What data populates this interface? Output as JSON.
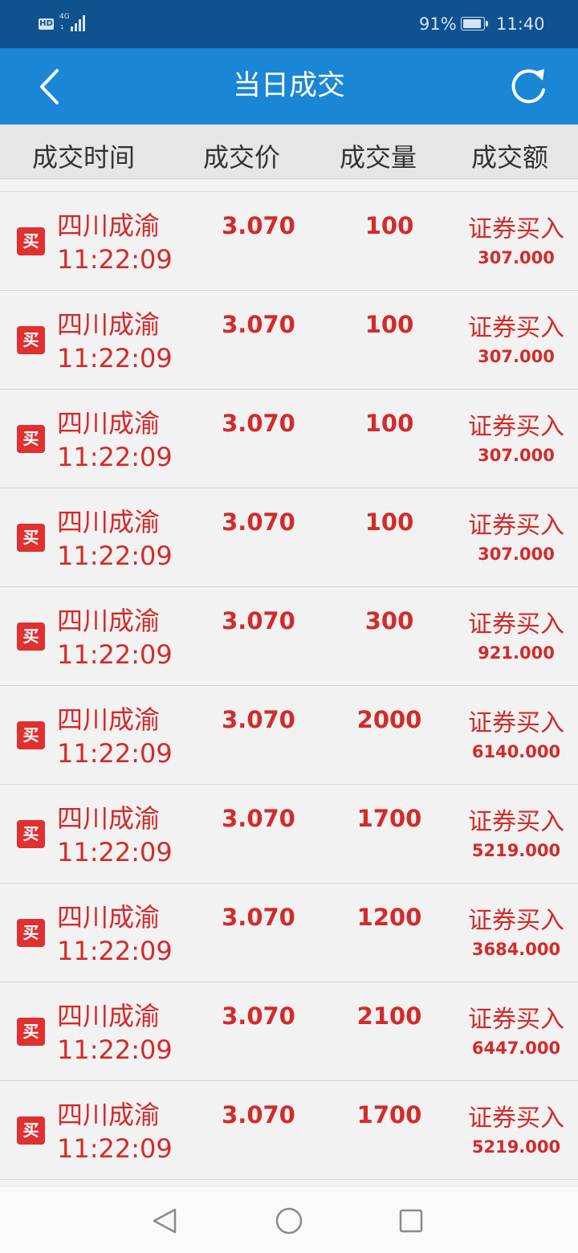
{
  "status_bar": {
    "hd_label": "HD",
    "network_label": "4G",
    "network_sub": "1",
    "battery_percent": "91%",
    "battery_level": 0.91,
    "time": "11:40"
  },
  "app_bar": {
    "title": "当日成交",
    "back_icon": "chevron-left-icon",
    "refresh_icon": "refresh-icon"
  },
  "table": {
    "columns": [
      "成交时间",
      "成交价",
      "成交量",
      "成交额"
    ],
    "rows": [
      {
        "badge": "买",
        "name": "四川成渝",
        "time": "11:22:09",
        "price": "3.070",
        "qty": "100",
        "type": "证券买入",
        "amount": "307.000"
      },
      {
        "badge": "买",
        "name": "四川成渝",
        "time": "11:22:09",
        "price": "3.070",
        "qty": "100",
        "type": "证券买入",
        "amount": "307.000"
      },
      {
        "badge": "买",
        "name": "四川成渝",
        "time": "11:22:09",
        "price": "3.070",
        "qty": "100",
        "type": "证券买入",
        "amount": "307.000"
      },
      {
        "badge": "买",
        "name": "四川成渝",
        "time": "11:22:09",
        "price": "3.070",
        "qty": "100",
        "type": "证券买入",
        "amount": "307.000"
      },
      {
        "badge": "买",
        "name": "四川成渝",
        "time": "11:22:09",
        "price": "3.070",
        "qty": "300",
        "type": "证券买入",
        "amount": "921.000"
      },
      {
        "badge": "买",
        "name": "四川成渝",
        "time": "11:22:09",
        "price": "3.070",
        "qty": "2000",
        "type": "证券买入",
        "amount": "6140.000"
      },
      {
        "badge": "买",
        "name": "四川成渝",
        "time": "11:22:09",
        "price": "3.070",
        "qty": "1700",
        "type": "证券买入",
        "amount": "5219.000"
      },
      {
        "badge": "买",
        "name": "四川成渝",
        "time": "11:22:09",
        "price": "3.070",
        "qty": "1200",
        "type": "证券买入",
        "amount": "3684.000"
      },
      {
        "badge": "买",
        "name": "四川成渝",
        "time": "11:22:09",
        "price": "3.070",
        "qty": "2100",
        "type": "证券买入",
        "amount": "6447.000"
      },
      {
        "badge": "买",
        "name": "四川成渝",
        "time": "11:22:09",
        "price": "3.070",
        "qty": "1700",
        "type": "证券买入",
        "amount": "5219.000"
      }
    ]
  },
  "nav_bar": {
    "back_icon": "triangle-back-icon",
    "home_icon": "circle-home-icon",
    "recent_icon": "square-recent-icon"
  },
  "colors": {
    "status_bar_bg": "#0e5290",
    "app_bar_bg": "#1a86d6",
    "accent_red": "#d42a2a",
    "badge_red": "#e03030",
    "row_bg": "#f2f2f2",
    "header_bg": "#e6e6e6"
  }
}
